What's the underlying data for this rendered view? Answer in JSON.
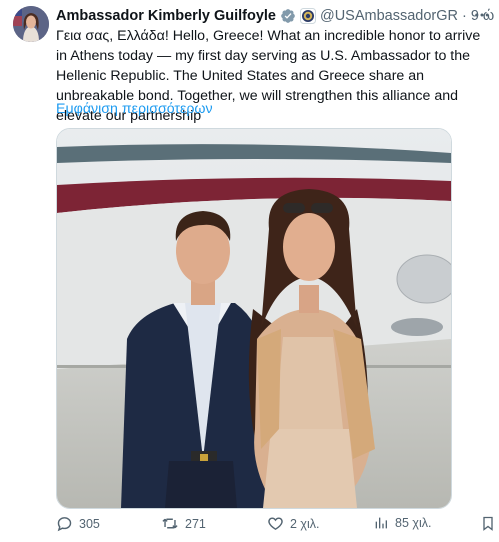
{
  "tweet": {
    "author_name": "Ambassador Kimberly Guilfoyle",
    "handle": "@USAmbassadorGR",
    "separator": "·",
    "time": "9 ώ",
    "text": "Γεια σας, Ελλάδα! Hello, Greece! What an incredible honor to arrive in Athens today — my first day serving as U.S. Ambassador to the Hellenic Republic. The United States and Greece share an unbreakable bond. Together, we will strengthen this alliance and elevate our partnership",
    "show_more": "Εμφάνιση περισσότερων"
  },
  "icons": {
    "avatar": "profile-photo",
    "verified": "verified-badge-icon",
    "affiliation": "us-seal-icon",
    "more": "more-options-icon",
    "reply": "reply-icon",
    "retweet": "retweet-icon",
    "like": "heart-icon",
    "views": "views-icon",
    "bookmark": "bookmark-icon"
  },
  "actions": {
    "reply_count": "305",
    "retweet_count": "271",
    "like_count": "2 χιλ.",
    "views_count": "85 χιλ."
  },
  "colors": {
    "accent": "#1d9bf0",
    "text": "#0f1419",
    "muted": "#536471",
    "background": "#ffffff"
  }
}
